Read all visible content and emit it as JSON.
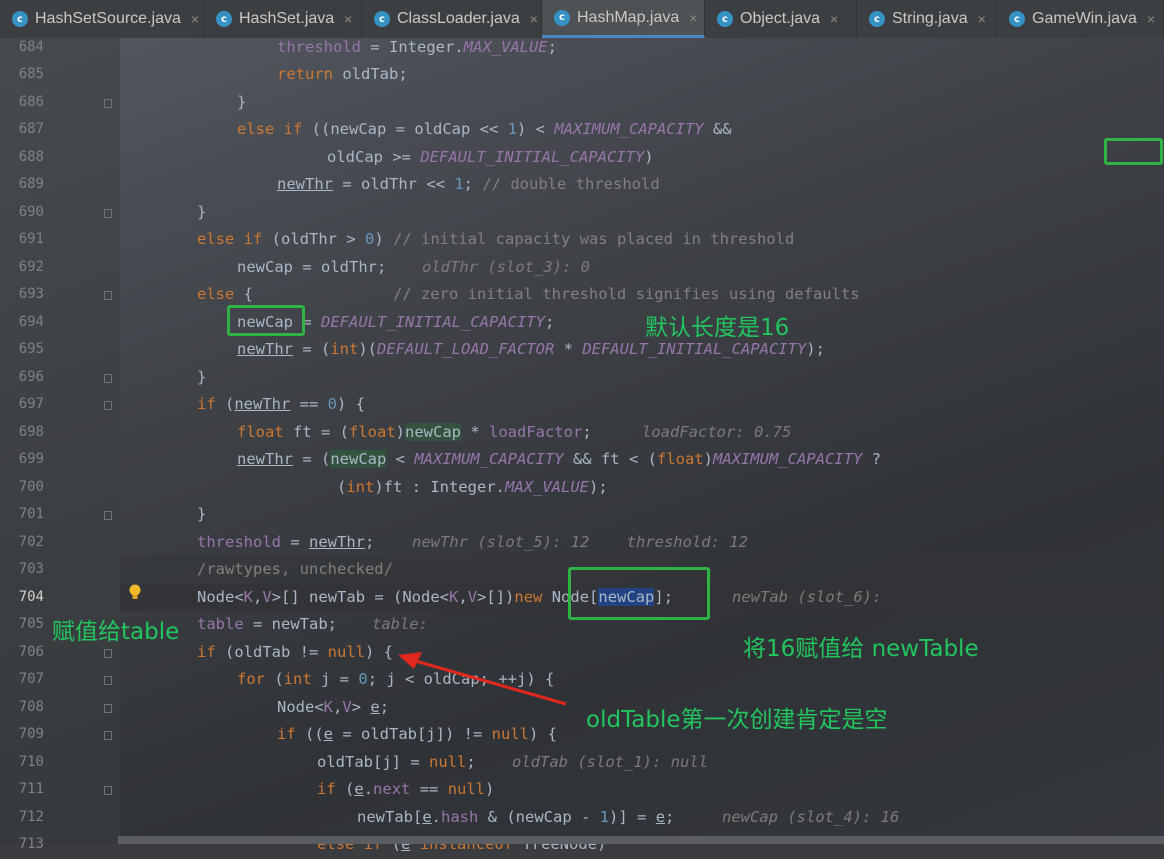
{
  "tabs": [
    {
      "label": "HashSetSource.java",
      "icon": "class-icon",
      "active": false
    },
    {
      "label": "HashSet.java",
      "icon": "class-icon",
      "active": false
    },
    {
      "label": "ClassLoader.java",
      "icon": "class-icon",
      "active": false
    },
    {
      "label": "HashMap.java",
      "icon": "class-icon",
      "active": true
    },
    {
      "label": "Object.java",
      "icon": "class-icon",
      "active": false
    },
    {
      "label": "String.java",
      "icon": "class-icon",
      "active": false
    },
    {
      "label": "GameWin.java",
      "icon": "class-icon",
      "active": false
    }
  ],
  "tab_close_glyph": "×",
  "tab_icon_glyph": "c",
  "line_numbers": [
    "684",
    "685",
    "686",
    "687",
    "688",
    "689",
    "690",
    "691",
    "692",
    "693",
    "694",
    "695",
    "696",
    "697",
    "698",
    "699",
    "700",
    "701",
    "702",
    "703",
    "704",
    "705",
    "706",
    "707",
    "708",
    "709",
    "710",
    "711",
    "712",
    "713"
  ],
  "current_line": "704",
  "code": {
    "l684": "threshold = Integer.MAX_VALUE;",
    "l685": "return oldTab;",
    "l686": "}",
    "l687": "else if ((newCap = oldCap << 1) < MAXIMUM_CAPACITY &&",
    "l688": "oldCap >= DEFAULT_INITIAL_CAPACITY)",
    "l689": "newThr = oldThr << 1; // double threshold",
    "l690": "}",
    "l691": "else if (oldThr > 0) // initial capacity was placed in threshold",
    "l692": "newCap = oldThr;",
    "l692_hint": "oldThr (slot_3): 0",
    "l693": "else {               // zero initial threshold signifies using defaults",
    "l694": "newCap = DEFAULT_INITIAL_CAPACITY;",
    "l695": "newThr = (int)(DEFAULT_LOAD_FACTOR * DEFAULT_INITIAL_CAPACITY);",
    "l696": "}",
    "l697": "if (newThr == 0) {",
    "l698": "float ft = (float)newCap * loadFactor;",
    "l698_hint": "loadFactor: 0.75",
    "l699": "newThr = (newCap < MAXIMUM_CAPACITY && ft < (float)MAXIMUM_CAPACITY ?",
    "l700": "(int)ft : Integer.MAX_VALUE);",
    "l701": "}",
    "l702": "threshold = newThr;",
    "l702_hint": "newThr (slot_5): 12    threshold: 12",
    "l703": "/rawtypes, unchecked/",
    "l704": "Node<K,V>[] newTab = (Node<K,V>[])new Node[newCap];",
    "l704_hint": "newTab (slot_6):",
    "l705": "table = newTab;",
    "l705_hint": "table:",
    "l706": "if (oldTab != null) {",
    "l707": "for (int j = 0; j < oldCap; ++j) {",
    "l708": "Node<K,V> e;",
    "l709": "if ((e = oldTab[j]) != null) {",
    "l710": "oldTab[j] = null;",
    "l710_hint": "oldTab (slot_1): null",
    "l711": "if (e.next == null)",
    "l712": "newTab[e.hash & (newCap - 1)] = e;",
    "l712_hint": "newCap (slot_4): 16",
    "l713": "else if (e instanceof TreeNode)"
  },
  "annotations": {
    "default_length": "默认长度是16",
    "assign_table": "赋值给table",
    "assign_new_table": "将16赋值给 newTable",
    "old_table_null": "oldTable第一次创建肯定是空"
  },
  "colors": {
    "annotation": "#22c55e",
    "arrow": "#e0281e",
    "box": "#2fb344",
    "keyword": "#cc7832",
    "field": "#9876aa",
    "number": "#6897bb"
  }
}
